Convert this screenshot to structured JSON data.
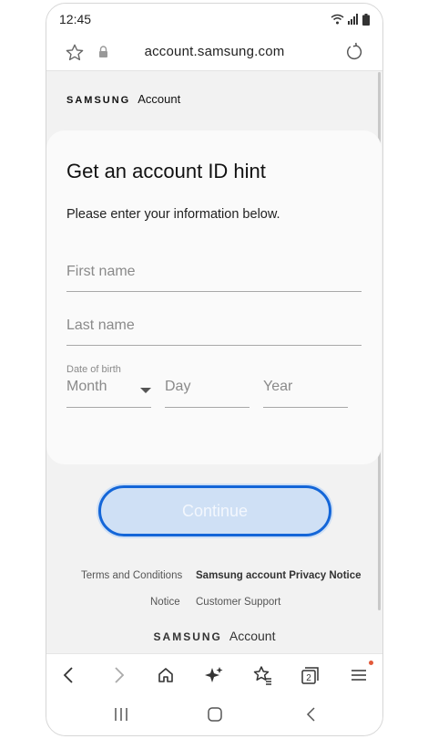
{
  "status": {
    "time": "12:45"
  },
  "browser": {
    "url": "account.samsung.com"
  },
  "header": {
    "brand_samsung": "SAMSUNG",
    "brand_account": "Account"
  },
  "form": {
    "title": "Get an account ID hint",
    "subtitle": "Please enter your information below.",
    "first_name_placeholder": "First name",
    "last_name_placeholder": "Last name",
    "dob_label": "Date of birth",
    "month_placeholder": "Month",
    "day_placeholder": "Day",
    "year_placeholder": "Year",
    "continue_label": "Continue"
  },
  "footer": {
    "terms": "Terms and Conditions",
    "privacy": "Samsung account Privacy Notice",
    "notice": "Notice",
    "support": "Customer Support",
    "brand_samsung": "SAMSUNG",
    "brand_account": "Account"
  },
  "toolbar": {
    "tabs_count": "2"
  },
  "colors": {
    "accent": "#1466d8",
    "button_fill": "#cfe0f5",
    "badge": "#e2593a"
  },
  "icons": [
    "star-outline-icon",
    "lock-icon",
    "reload-icon",
    "back-icon",
    "forward-icon",
    "home-icon",
    "sparkle-icon",
    "bookmarks-icon",
    "tabs-icon",
    "menu-icon",
    "recents-icon",
    "home-circle-icon",
    "nav-back-icon"
  ]
}
